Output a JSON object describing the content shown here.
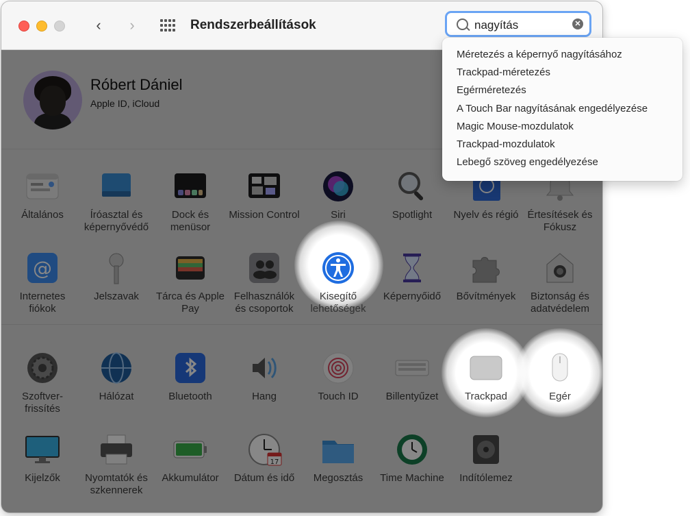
{
  "window": {
    "title": "Rendszerbeállítások"
  },
  "search": {
    "value": "nagyítás"
  },
  "profile": {
    "name": "Róbert Dániel",
    "subtitle": "Apple ID, iCloud"
  },
  "suggestions": [
    "Méretezés a képernyő nagyításához",
    "Trackpad-méretezés",
    "Egérméretezés",
    "A Touch Bar nagyításának engedélyezése",
    "Magic Mouse-mozdulatok",
    "Trackpad-mozdulatok",
    "Lebegő szöveg engedélyezése"
  ],
  "row1": [
    {
      "label": "Általános",
      "icon": "general-icon"
    },
    {
      "label": "Íróasztal és képernyővédő",
      "icon": "desktop-icon"
    },
    {
      "label": "Dock és menüsor",
      "icon": "dock-icon"
    },
    {
      "label": "Mission Control",
      "icon": "mission-control-icon"
    },
    {
      "label": "Siri",
      "icon": "siri-icon"
    },
    {
      "label": "Spotlight",
      "icon": "spotlight-icon"
    },
    {
      "label": "Nyelv és régió",
      "icon": "language-icon"
    },
    {
      "label": "Értesítések és Fókusz",
      "icon": "notifications-icon"
    }
  ],
  "row2": [
    {
      "label": "Internetes fiókok",
      "icon": "internet-accounts-icon"
    },
    {
      "label": "Jelszavak",
      "icon": "key-icon"
    },
    {
      "label": "Tárca és Apple Pay",
      "icon": "wallet-icon"
    },
    {
      "label": "Felhasználók és csoportok",
      "icon": "users-icon"
    },
    {
      "label": "Kisegítő lehetőségek",
      "icon": "accessibility-icon"
    },
    {
      "label": "Képernyőidő",
      "icon": "hourglass-icon"
    },
    {
      "label": "Bővítmények",
      "icon": "puzzle-icon"
    },
    {
      "label": "Biztonság és adatvédelem",
      "icon": "security-icon"
    }
  ],
  "row3": [
    {
      "label": "Szoftver-frissítés",
      "icon": "gear-icon"
    },
    {
      "label": "Hálózat",
      "icon": "globe-icon"
    },
    {
      "label": "Bluetooth",
      "icon": "bluetooth-icon"
    },
    {
      "label": "Hang",
      "icon": "speaker-icon"
    },
    {
      "label": "Touch ID",
      "icon": "fingerprint-icon"
    },
    {
      "label": "Billentyűzet",
      "icon": "keyboard-icon"
    },
    {
      "label": "Trackpad",
      "icon": "trackpad-icon"
    },
    {
      "label": "Egér",
      "icon": "mouse-icon"
    }
  ],
  "row4": [
    {
      "label": "Kijelzők",
      "icon": "display-icon"
    },
    {
      "label": "Nyomtatók és szkennerek",
      "icon": "printer-icon"
    },
    {
      "label": "Akkumulátor",
      "icon": "battery-icon"
    },
    {
      "label": "Dátum és idő",
      "icon": "clock-icon",
      "badge": "17"
    },
    {
      "label": "Megosztás",
      "icon": "folder-icon"
    },
    {
      "label": "Time Machine",
      "icon": "time-machine-icon"
    },
    {
      "label": "Indítólemez",
      "icon": "disk-icon"
    }
  ]
}
